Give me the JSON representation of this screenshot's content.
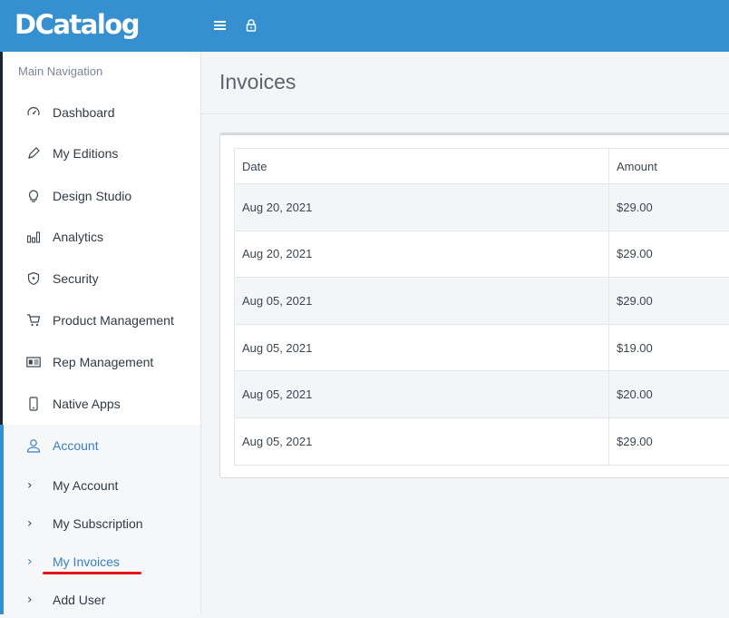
{
  "brand": {
    "logo": "DCatalog",
    "primary_color": "#3690cf",
    "highlight_color": "#e3151a"
  },
  "topbar": {
    "menu_icon": "hamburger-icon",
    "lock_icon": "lock-icon"
  },
  "sidebar": {
    "title": "Main Navigation",
    "items": [
      {
        "label": "Dashboard",
        "icon": "speedometer-icon"
      },
      {
        "label": "My Editions",
        "icon": "pencil-icon"
      },
      {
        "label": "Design Studio",
        "icon": "lightbulb-icon"
      },
      {
        "label": "Analytics",
        "icon": "bar-chart-icon"
      },
      {
        "label": "Security",
        "icon": "shield-icon"
      },
      {
        "label": "Product Management",
        "icon": "cart-icon"
      },
      {
        "label": "Rep Management",
        "icon": "id-card-icon"
      },
      {
        "label": "Native Apps",
        "icon": "phone-icon"
      },
      {
        "label": "Account",
        "icon": "user-icon"
      }
    ],
    "account_subitems": [
      {
        "label": "My Account"
      },
      {
        "label": "My Subscription"
      },
      {
        "label": "My Invoices"
      },
      {
        "label": "Add User"
      }
    ],
    "chevron": "›"
  },
  "page": {
    "title": "Invoices"
  },
  "invoices": {
    "columns": [
      "Date",
      "Amount"
    ],
    "rows": [
      [
        "Aug 20, 2021",
        "$29.00"
      ],
      [
        "Aug 20, 2021",
        "$29.00"
      ],
      [
        "Aug 05, 2021",
        "$29.00"
      ],
      [
        "Aug 05, 2021",
        "$19.00"
      ],
      [
        "Aug 05, 2021",
        "$20.00"
      ],
      [
        "Aug 05, 2021",
        "$29.00"
      ]
    ]
  }
}
